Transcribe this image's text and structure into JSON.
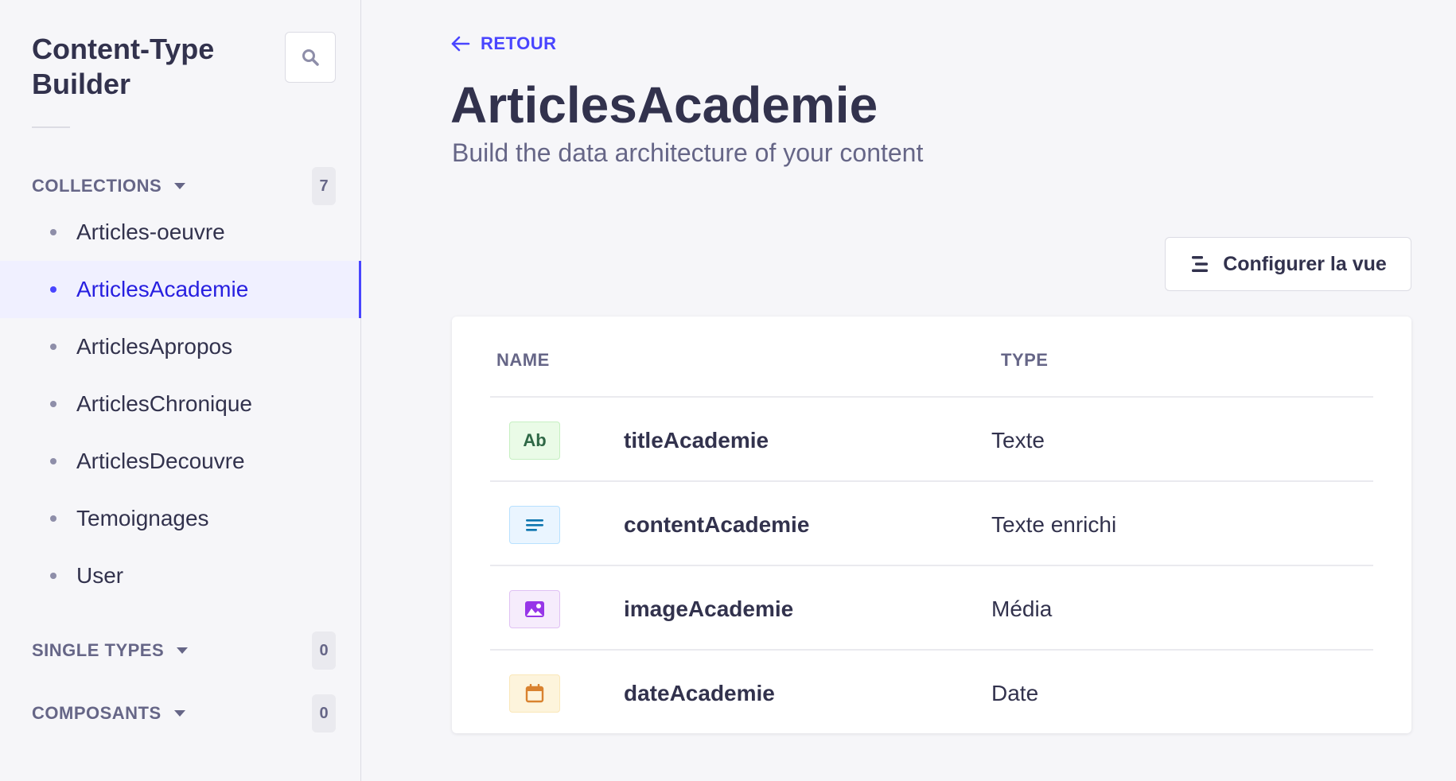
{
  "sidebar": {
    "title": "Content-Type Builder",
    "sections": [
      {
        "label": "COLLECTIONS",
        "count": "7"
      },
      {
        "label": "SINGLE TYPES",
        "count": "0"
      },
      {
        "label": "COMPOSANTS",
        "count": "0"
      }
    ],
    "collections": [
      {
        "label": "Articles-oeuvre"
      },
      {
        "label": "ArticlesAcademie"
      },
      {
        "label": "ArticlesApropos"
      },
      {
        "label": "ArticlesChronique"
      },
      {
        "label": "ArticlesDecouvre"
      },
      {
        "label": "Temoignages"
      },
      {
        "label": "User"
      }
    ],
    "active_item": "ArticlesAcademie"
  },
  "header": {
    "back_label": "RETOUR",
    "title": "ArticlesAcademie",
    "subtitle": "Build the data architecture of your content"
  },
  "toolbar": {
    "configure_label": "Configurer la vue"
  },
  "table": {
    "columns": [
      "NAME",
      "TYPE"
    ],
    "rows": [
      {
        "icon": "text-icon",
        "icon_text": "Ab",
        "name": "titleAcademie",
        "type": "Texte"
      },
      {
        "icon": "rich-text-icon",
        "name": "contentAcademie",
        "type": "Texte enrichi"
      },
      {
        "icon": "media-icon",
        "name": "imageAcademie",
        "type": "Média"
      },
      {
        "icon": "calendar-icon",
        "name": "dateAcademie",
        "type": "Date"
      }
    ]
  },
  "colors": {
    "accent": "#4945ff",
    "active_text": "#271fe0",
    "text": "#32324d",
    "muted": "#666687",
    "background": "#f6f6f9"
  }
}
